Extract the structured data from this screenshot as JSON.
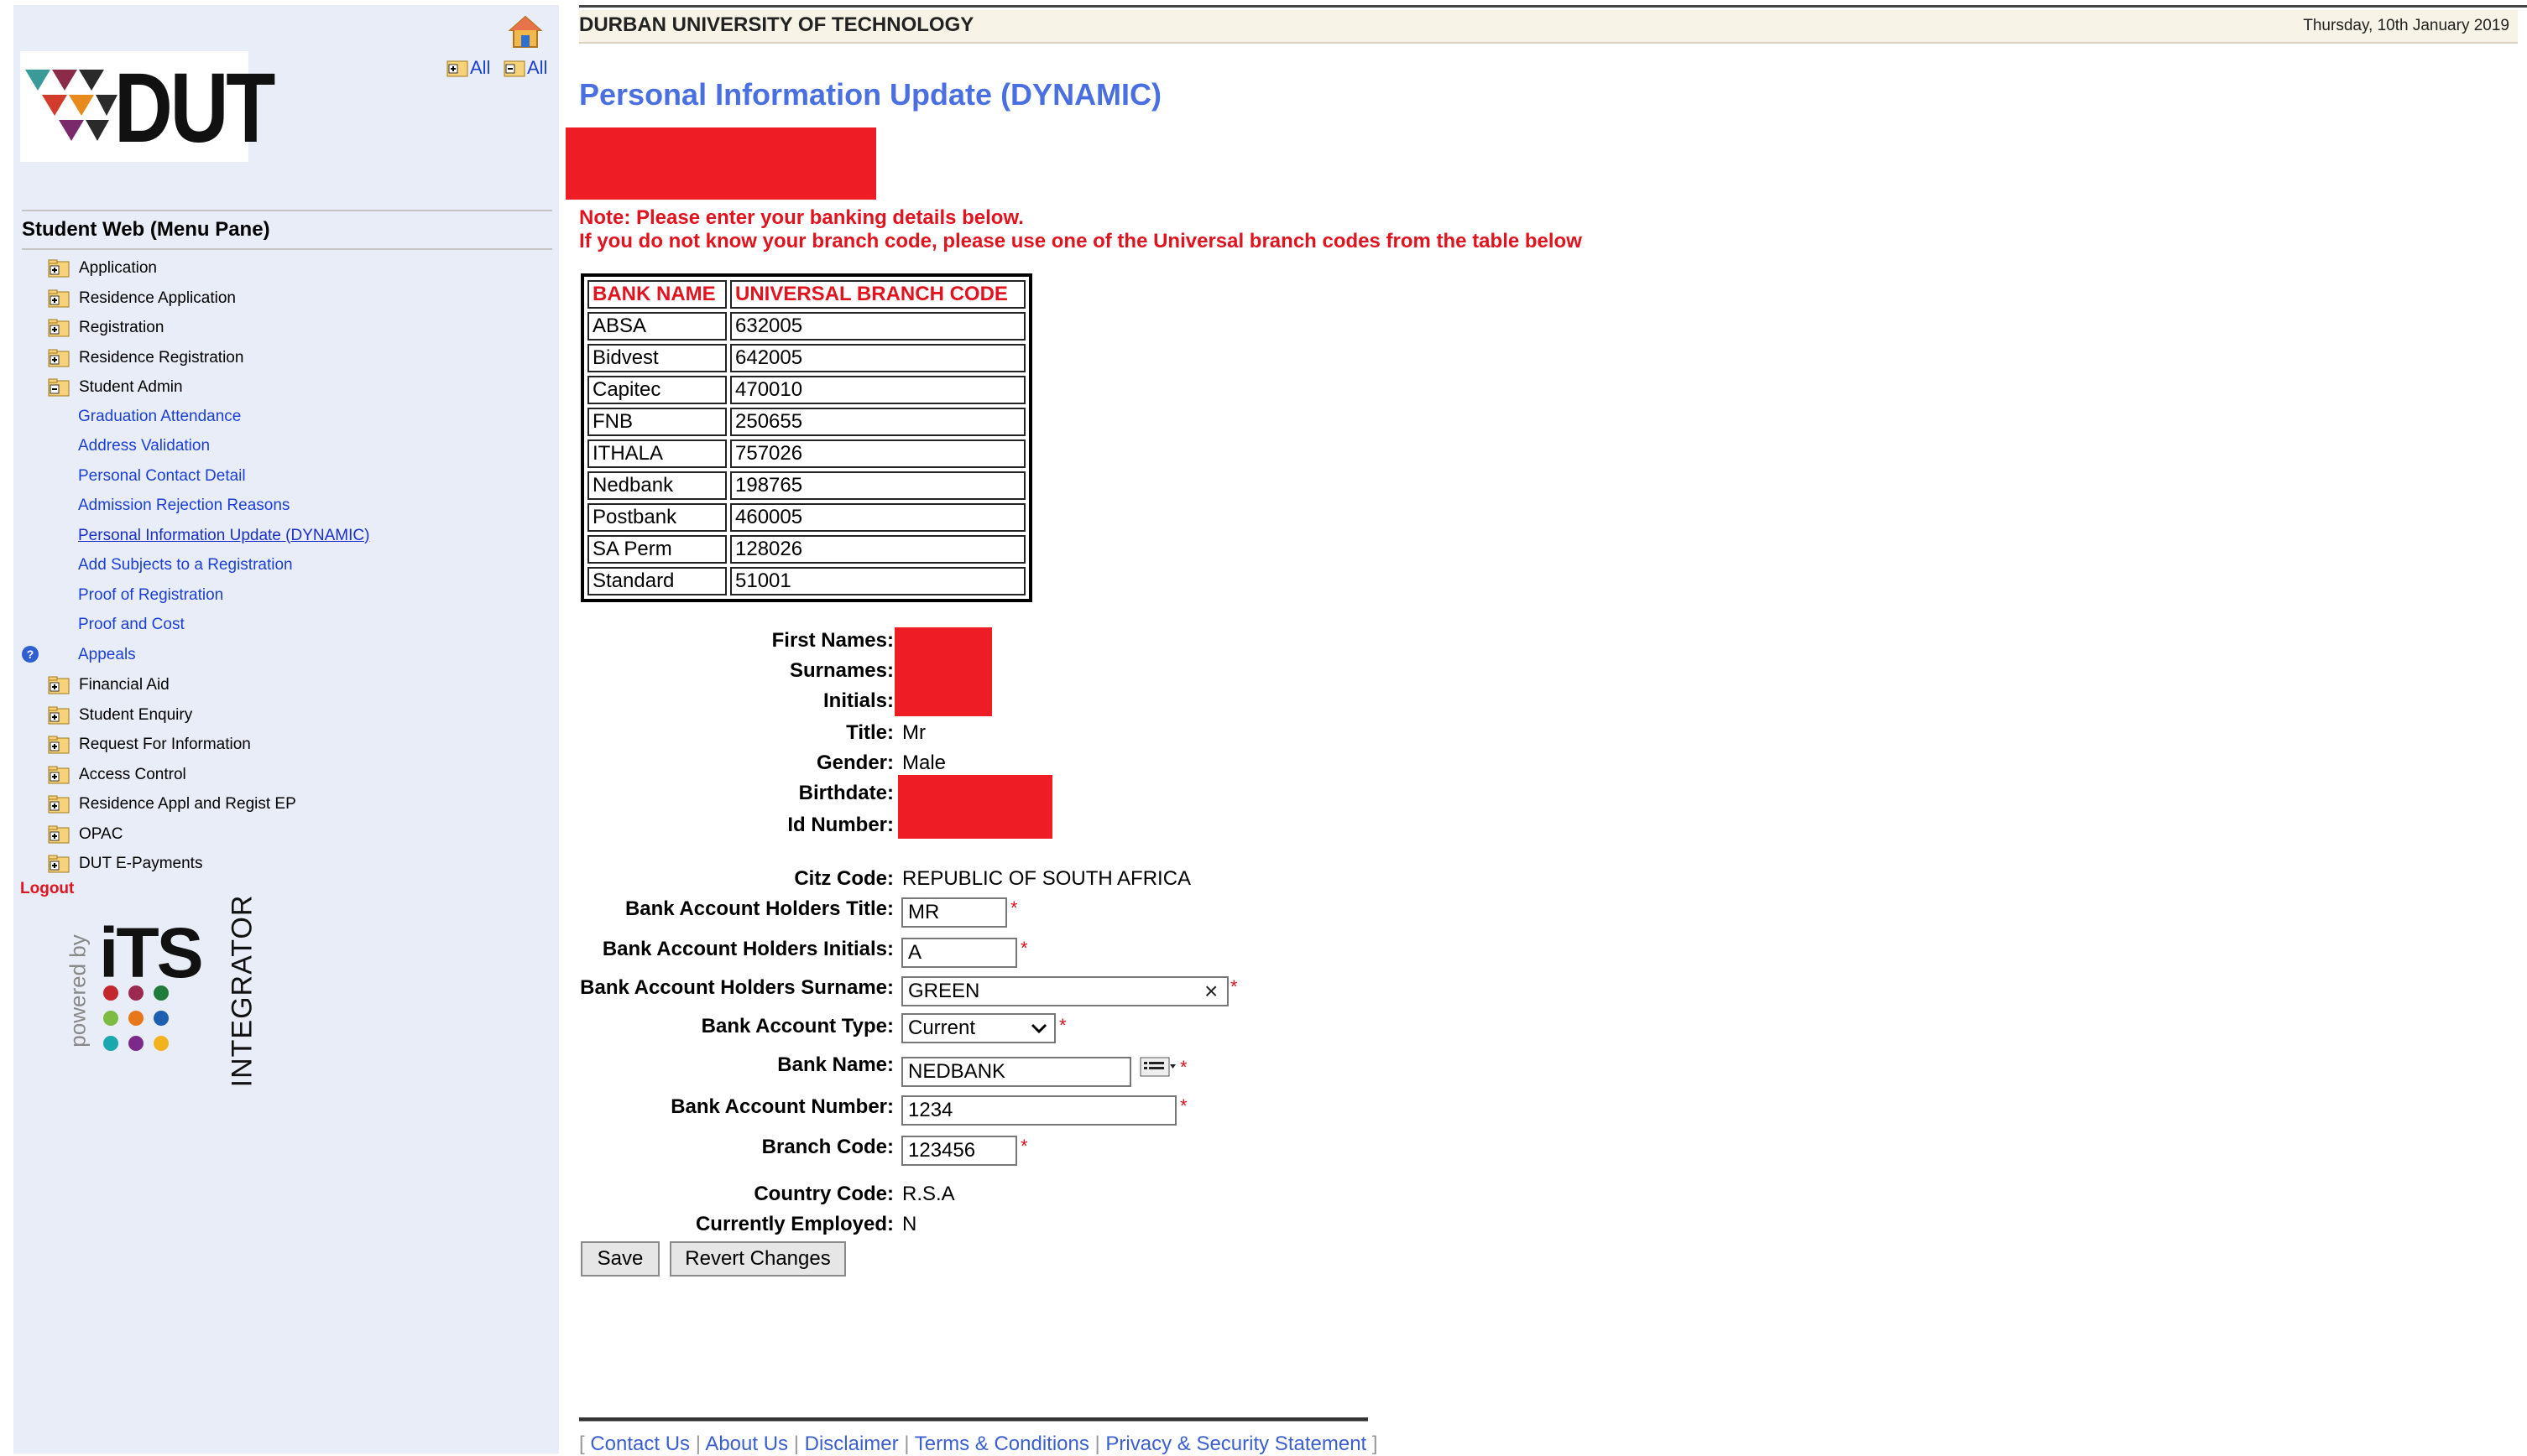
{
  "sidebar": {
    "logo_text": "DUT",
    "expand_all": "All",
    "collapse_all": "All",
    "title": "Student Web (Menu Pane)",
    "menu": [
      {
        "label": "Application"
      },
      {
        "label": "Residence Application"
      },
      {
        "label": "Registration"
      },
      {
        "label": "Residence Registration"
      },
      {
        "label": "Student Admin"
      }
    ],
    "student_admin_items": [
      "Graduation Attendance",
      "Address Validation",
      "Personal Contact Detail",
      "Admission Rejection Reasons",
      "Personal Information Update (DYNAMIC)",
      "Add Subjects to a Registration",
      "Proof of Registration",
      "Proof and Cost",
      "Appeals"
    ],
    "menu_after": [
      {
        "label": "Financial Aid"
      },
      {
        "label": "Student Enquiry"
      },
      {
        "label": "Request For Information"
      },
      {
        "label": "Access Control"
      },
      {
        "label": "Residence Appl and Regist EP"
      },
      {
        "label": "OPAC"
      },
      {
        "label": "DUT E-Payments"
      }
    ],
    "logout": "Logout",
    "powered_by": "powered by",
    "its_text": "iTS",
    "integrator_text": "INTEGRATOR"
  },
  "header": {
    "university": "DURBAN UNIVERSITY OF TECHNOLOGY",
    "date": "Thursday, 10th January 2019"
  },
  "page_title": "Personal Information Update (DYNAMIC)",
  "notes": {
    "line1": "Note: Please enter your banking details below.",
    "line2": "If you do not know your branch code, please use one of the Universal branch codes from the table below"
  },
  "bank_table": {
    "headers": [
      "BANK NAME",
      "UNIVERSAL BRANCH CODE"
    ],
    "rows": [
      [
        "ABSA",
        "632005"
      ],
      [
        "Bidvest",
        "642005"
      ],
      [
        "Capitec",
        "470010"
      ],
      [
        "FNB",
        "250655"
      ],
      [
        "ITHALA",
        "757026"
      ],
      [
        "Nedbank",
        "198765"
      ],
      [
        "Postbank",
        "460005"
      ],
      [
        "SA Perm",
        "128026"
      ],
      [
        "Standard",
        "51001"
      ]
    ]
  },
  "personal": {
    "first_names_label": "First Names:",
    "surnames_label": "Surnames:",
    "initials_label": "Initials:",
    "title_label": "Title:",
    "title_value": "Mr",
    "gender_label": "Gender:",
    "gender_value": "Male",
    "birthdate_label": "Birthdate:",
    "id_label": "Id Number:",
    "citz_label": "Citz Code:",
    "citz_value": "REPUBLIC OF SOUTH AFRICA"
  },
  "bank_form": {
    "holder_title_label": "Bank Account Holders Title:",
    "holder_title_value": "MR",
    "holder_initials_label": "Bank Account Holders Initials:",
    "holder_initials_value": "A",
    "holder_surname_label": "Bank Account Holders Surname:",
    "holder_surname_value": "GREEN",
    "account_type_label": "Bank Account Type:",
    "account_type_value": "Current",
    "bank_name_label": "Bank Name:",
    "bank_name_value": "NEDBANK",
    "account_number_label": "Bank Account Number:",
    "account_number_value": "1234",
    "branch_code_label": "Branch Code:",
    "branch_code_value": "123456",
    "country_code_label": "Country Code:",
    "country_code_value": "R.S.A",
    "employed_label": "Currently Employed:",
    "employed_value": "N",
    "required_marker": "*"
  },
  "buttons": {
    "save": "Save",
    "revert": "Revert Changes"
  },
  "footer": {
    "links": [
      "Contact Us",
      "About Us",
      "Disclaimer",
      "Terms & Conditions",
      "Privacy & Security Statement"
    ]
  },
  "colors": {
    "link": "#1a3fd6",
    "required": "#e0131e",
    "title": "#4a6fe0",
    "sidebar_bg": "#e8edf7"
  }
}
